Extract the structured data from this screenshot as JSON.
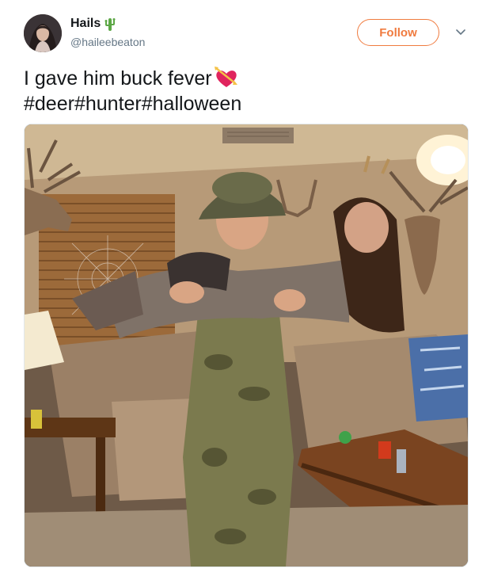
{
  "user": {
    "display_name": "Hails",
    "name_emoji_icon": "cactus-icon",
    "handle": "@haileebeaton"
  },
  "actions": {
    "follow_label": "Follow",
    "menu_icon": "chevron-down-icon"
  },
  "tweet": {
    "line1": "I gave him buck fever",
    "line1_emoji_icon": "heart-with-arrow-icon",
    "hashtags": [
      "#deer",
      "#hunter",
      "#halloween"
    ]
  },
  "colors": {
    "accent": "#f07b3f",
    "text": "#14171a",
    "secondary_text": "#657786"
  }
}
